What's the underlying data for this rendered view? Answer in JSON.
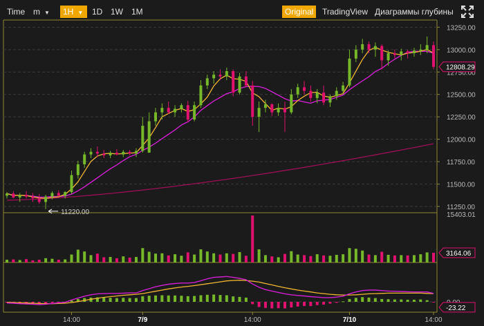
{
  "toolbar": {
    "time_label": "Time",
    "minutes_label": "m",
    "interval_1h": "1H",
    "interval_1d": "1D",
    "interval_1w": "1W",
    "interval_1m": "1M",
    "view_original": "Original",
    "view_tradingview": "TradingView",
    "view_depth": "Диаграммы глубины",
    "fullscreen_icon": "expand-icon"
  },
  "colors": {
    "up": "#76b82a",
    "down": "#e0126e",
    "ma_fast": "#f2b632",
    "ma_mid": "#d21ed2",
    "ma_slow": "#9b0f55",
    "border": "#8f8a35",
    "accent": "#f0a800"
  },
  "chart_data": {
    "type": "candlestick",
    "x_ticks": [
      "14:00",
      "7/9",
      "14:00",
      "7/10",
      "14:00"
    ],
    "price_axis": {
      "ticks": [
        13250,
        13000,
        12750,
        12500,
        12250,
        12000,
        11750,
        11500,
        11250
      ],
      "tick_labels": [
        "13250.00",
        "13000.00",
        "12750.00",
        "12500.00",
        "12250.00",
        "12000.00",
        "11750.00",
        "11500.00",
        "11250.00"
      ],
      "ylim": [
        11180,
        13330
      ],
      "current_price": 12808.29,
      "current_price_label": "12808.29",
      "high": 13147.08,
      "high_label": "13147.08",
      "low": 11220.0,
      "low_label": "11220.00"
    },
    "volume_axis": {
      "max_label": "15403.01",
      "max": 15403.01,
      "current_label": "3164.06",
      "current": 3164.06
    },
    "macd_axis": {
      "zero_label": "0.00",
      "current_label": "-23.22",
      "current": -23.22
    },
    "candles": [
      [
        11370,
        11410,
        11340,
        11395
      ],
      [
        11395,
        11420,
        11340,
        11350
      ],
      [
        11350,
        11400,
        11300,
        11380
      ],
      [
        11380,
        11420,
        11340,
        11360
      ],
      [
        11360,
        11400,
        11300,
        11340
      ],
      [
        11340,
        11390,
        11280,
        11300
      ],
      [
        11300,
        11380,
        11220,
        11360
      ],
      [
        11360,
        11420,
        11330,
        11400
      ],
      [
        11400,
        11430,
        11360,
        11370
      ],
      [
        11370,
        11420,
        11340,
        11410
      ],
      [
        11410,
        11650,
        11390,
        11600
      ],
      [
        11600,
        11760,
        11560,
        11720
      ],
      [
        11720,
        11860,
        11680,
        11830
      ],
      [
        11830,
        11900,
        11790,
        11860
      ],
      [
        11860,
        11920,
        11800,
        11840
      ],
      [
        11840,
        11880,
        11790,
        11820
      ],
      [
        11820,
        11870,
        11790,
        11850
      ],
      [
        11850,
        11890,
        11820,
        11830
      ],
      [
        11830,
        11880,
        11800,
        11860
      ],
      [
        11860,
        11880,
        11820,
        11840
      ],
      [
        11840,
        11900,
        11800,
        11870
      ],
      [
        11870,
        12250,
        11850,
        12150
      ],
      [
        11850,
        12300,
        11850,
        12200
      ],
      [
        12200,
        12350,
        12150,
        12300
      ],
      [
        12300,
        12400,
        12220,
        12350
      ],
      [
        12350,
        12420,
        12280,
        12300
      ],
      [
        12300,
        12380,
        12250,
        12340
      ],
      [
        12340,
        12400,
        12300,
        12380
      ],
      [
        12380,
        12430,
        12190,
        12220
      ],
      [
        12220,
        12420,
        12200,
        12380
      ],
      [
        12380,
        12660,
        12350,
        12600
      ],
      [
        12600,
        12720,
        12560,
        12680
      ],
      [
        12680,
        12760,
        12620,
        12720
      ],
      [
        12720,
        12780,
        12660,
        12700
      ],
      [
        12700,
        12800,
        12660,
        12760
      ],
      [
        12760,
        12780,
        12480,
        12520
      ],
      [
        12520,
        12740,
        12500,
        12700
      ],
      [
        12700,
        12760,
        12580,
        12600
      ],
      [
        12600,
        12650,
        12150,
        12250
      ],
      [
        12250,
        12420,
        12080,
        12350
      ],
      [
        12350,
        12440,
        12300,
        12390
      ],
      [
        12390,
        12400,
        12260,
        12300
      ],
      [
        12300,
        12400,
        12260,
        12350
      ],
      [
        12350,
        12420,
        12080,
        12300
      ],
      [
        12300,
        12560,
        12280,
        12500
      ],
      [
        12500,
        12620,
        12460,
        12580
      ],
      [
        12580,
        12650,
        12500,
        12540
      ],
      [
        12540,
        12600,
        12420,
        12460
      ],
      [
        12460,
        12560,
        12400,
        12520
      ],
      [
        12520,
        12600,
        12380,
        12410
      ],
      [
        12410,
        12500,
        12360,
        12480
      ],
      [
        12480,
        12580,
        12440,
        12540
      ],
      [
        12540,
        12640,
        12500,
        12600
      ],
      [
        12600,
        13000,
        12580,
        12900
      ],
      [
        12900,
        13050,
        12860,
        13000
      ],
      [
        13000,
        13120,
        12960,
        13060
      ],
      [
        13060,
        13090,
        12960,
        13000
      ],
      [
        13000,
        13080,
        12920,
        13040
      ],
      [
        13040,
        13060,
        12780,
        12880
      ],
      [
        12880,
        12990,
        12820,
        12960
      ],
      [
        12960,
        13000,
        12900,
        12940
      ],
      [
        12940,
        13010,
        12880,
        12980
      ],
      [
        12980,
        13000,
        12900,
        12960
      ],
      [
        12960,
        13020,
        12920,
        12990
      ],
      [
        12990,
        13060,
        12940,
        13000
      ],
      [
        13000,
        13147,
        12960,
        13050
      ],
      [
        13050,
        13090,
        12780,
        12808
      ]
    ],
    "volumes": [
      900,
      1000,
      800,
      1100,
      700,
      900,
      1400,
      1200,
      900,
      1000,
      2600,
      4200,
      3600,
      2400,
      2900,
      1700,
      1800,
      1400,
      2000,
      1600,
      1800,
      4700,
      3500,
      2900,
      3000,
      2300,
      2700,
      2200,
      3300,
      2600,
      4300,
      3600,
      3000,
      2600,
      3000,
      2800,
      3400,
      2200,
      15403,
      4300,
      2400,
      2000,
      1700,
      2800,
      3700,
      2600,
      2400,
      2100,
      2700,
      2300,
      2200,
      2500,
      2700,
      4700,
      4500,
      3900,
      2600,
      2400,
      3500,
      2500,
      2300,
      2400,
      2300,
      2400,
      2700,
      3300,
      3164
    ],
    "macd_hist": [
      -4,
      -6,
      -7,
      -8,
      -9,
      -10,
      -7,
      -5,
      -3,
      -1,
      6,
      12,
      16,
      18,
      19,
      18,
      17,
      16,
      17,
      16,
      16,
      24,
      26,
      27,
      28,
      27,
      27,
      26,
      24,
      25,
      28,
      30,
      31,
      29,
      28,
      23,
      21,
      18,
      -10,
      -22,
      -26,
      -28,
      -27,
      -28,
      -24,
      -20,
      -18,
      -18,
      -14,
      -12,
      -8,
      -4,
      2,
      12,
      17,
      20,
      18,
      16,
      12,
      11,
      10,
      10,
      9,
      9,
      10,
      7,
      -3
    ],
    "macd_line": [
      -5,
      -6,
      -8,
      -9,
      -10,
      -12,
      -10,
      -7,
      -4,
      -2,
      8,
      16,
      24,
      30,
      34,
      35,
      36,
      36,
      37,
      38,
      38,
      48,
      56,
      64,
      70,
      75,
      78,
      80,
      80,
      82,
      90,
      98,
      104,
      106,
      108,
      104,
      100,
      94,
      76,
      62,
      52,
      46,
      40,
      34,
      30,
      27,
      25,
      22,
      20,
      18,
      18,
      20,
      24,
      34,
      42,
      48,
      50,
      50,
      48,
      46,
      45,
      44,
      43,
      42,
      42,
      42,
      36
    ],
    "signal_line": [
      -2,
      -3,
      -4,
      -5,
      -6,
      -7,
      -8,
      -8,
      -7,
      -6,
      -3,
      1,
      6,
      11,
      15,
      19,
      22,
      25,
      28,
      30,
      32,
      35,
      40,
      45,
      50,
      55,
      59,
      63,
      66,
      69,
      73,
      77,
      81,
      85,
      89,
      91,
      92,
      91,
      88,
      84,
      78,
      72,
      66,
      60,
      55,
      50,
      46,
      42,
      38,
      35,
      32,
      30,
      29,
      29,
      30,
      32,
      34,
      35,
      36,
      37,
      37,
      37,
      37,
      37,
      37,
      36,
      35
    ]
  }
}
